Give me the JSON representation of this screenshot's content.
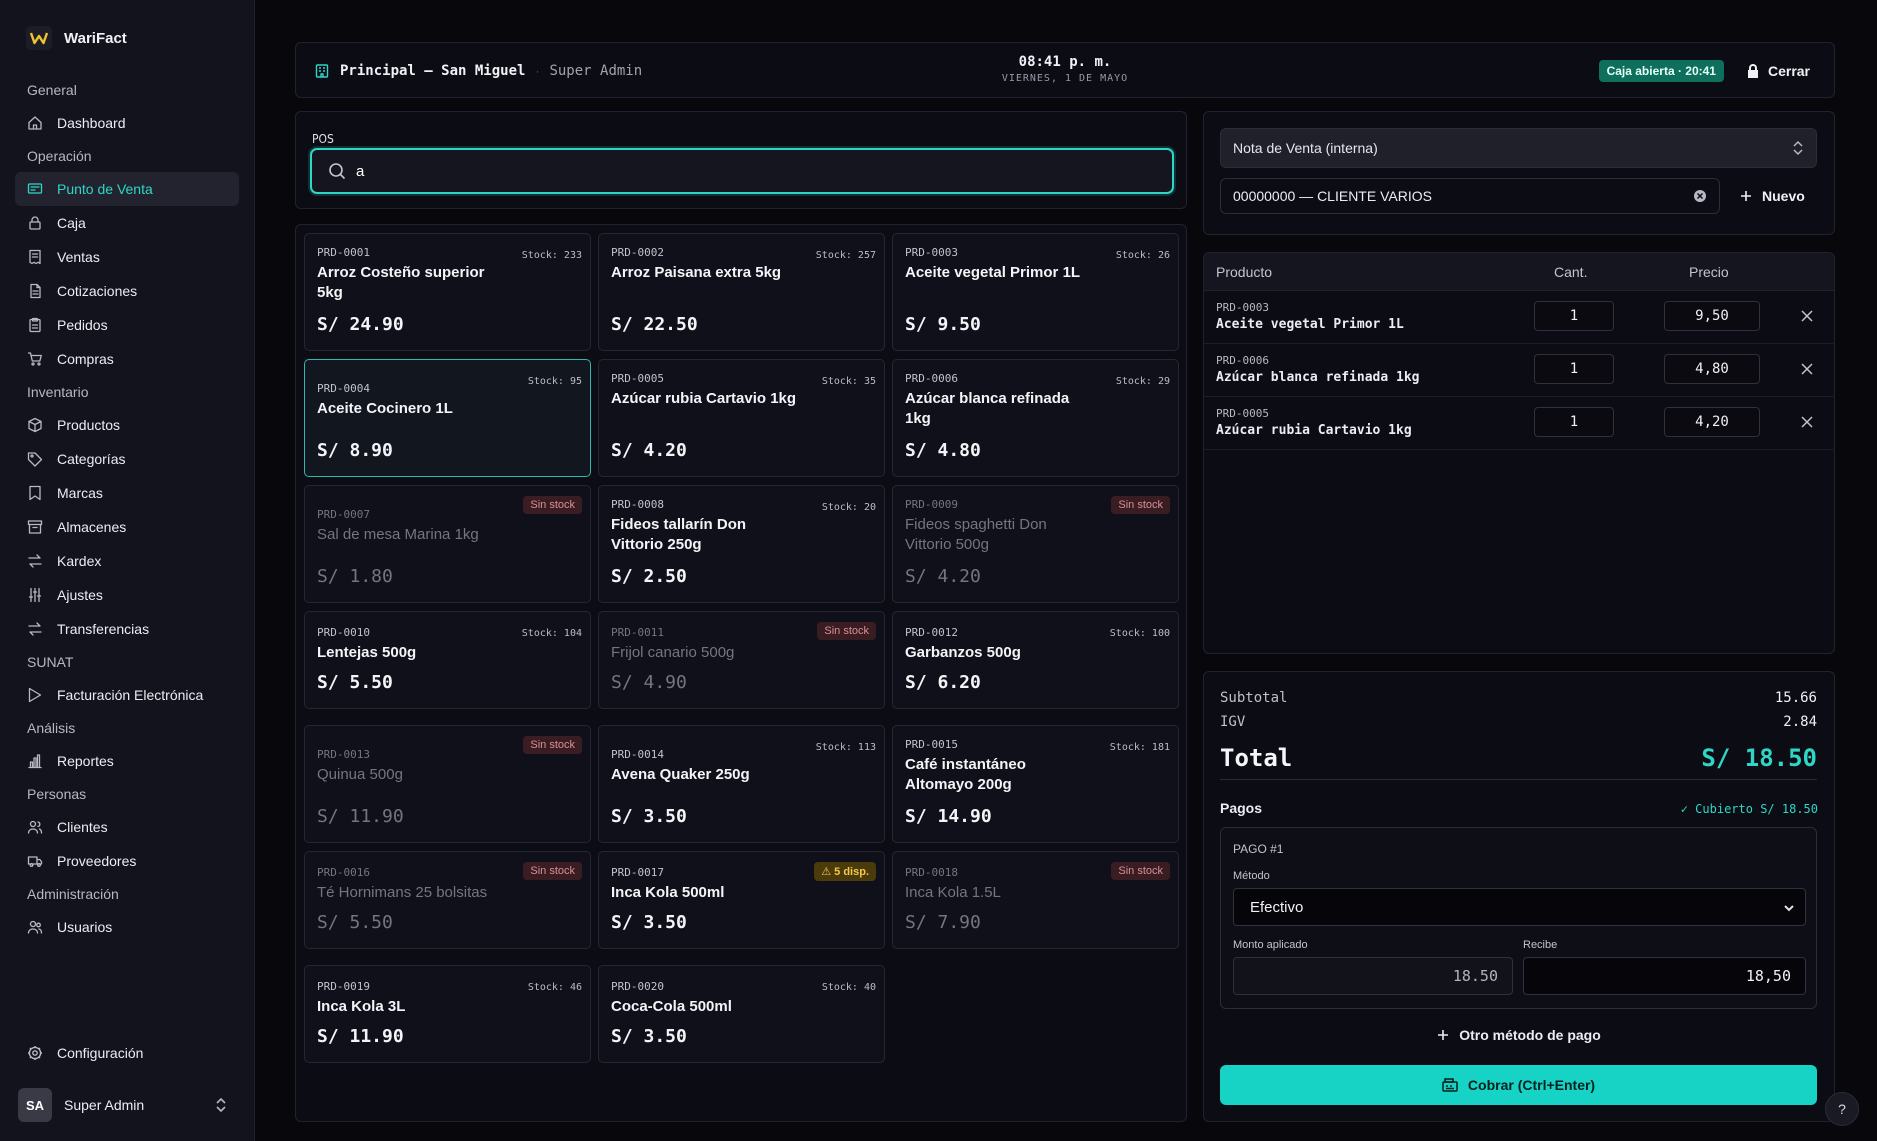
{
  "brand": {
    "name": "WariFact"
  },
  "sidebar": {
    "sections": [
      {
        "title": "General",
        "items": [
          {
            "label": "Dashboard",
            "icon": "home-icon"
          }
        ]
      },
      {
        "title": "Operación",
        "items": [
          {
            "label": "Punto de Venta",
            "icon": "pos-icon",
            "active": true
          },
          {
            "label": "Caja",
            "icon": "lock-icon"
          },
          {
            "label": "Ventas",
            "icon": "receipt-icon"
          },
          {
            "label": "Cotizaciones",
            "icon": "document-icon"
          },
          {
            "label": "Pedidos",
            "icon": "clipboard-icon"
          },
          {
            "label": "Compras",
            "icon": "cart-icon"
          }
        ]
      },
      {
        "title": "Inventario",
        "items": [
          {
            "label": "Productos",
            "icon": "box-icon"
          },
          {
            "label": "Categorías",
            "icon": "tag-icon"
          },
          {
            "label": "Marcas",
            "icon": "bookmark-icon"
          },
          {
            "label": "Almacenes",
            "icon": "archive-icon"
          },
          {
            "label": "Kardex",
            "icon": "swap-icon"
          },
          {
            "label": "Ajustes",
            "icon": "sliders-icon"
          },
          {
            "label": "Transferencias",
            "icon": "transfer-icon"
          }
        ]
      },
      {
        "title": "SUNAT",
        "items": [
          {
            "label": "Facturación Electrónica",
            "icon": "send-icon"
          }
        ]
      },
      {
        "title": "Análisis",
        "items": [
          {
            "label": "Reportes",
            "icon": "bar-chart-icon"
          }
        ]
      },
      {
        "title": "Personas",
        "items": [
          {
            "label": "Clientes",
            "icon": "users-icon"
          },
          {
            "label": "Proveedores",
            "icon": "truck-icon"
          }
        ]
      },
      {
        "title": "Administración",
        "items": [
          {
            "label": "Usuarios",
            "icon": "user-group-icon"
          }
        ]
      }
    ],
    "config_label": "Configuración",
    "user": {
      "initials": "SA",
      "name": "Super Admin"
    }
  },
  "header": {
    "store": "Principal — San Miguel",
    "role": "Super Admin",
    "time": "08:41 p. m.",
    "date": "VIERNES, 1 DE MAYO",
    "cash_status": "Caja abierta · 20:41",
    "close_label": "Cerrar"
  },
  "search": {
    "label": "POS",
    "value": "a"
  },
  "products": [
    {
      "code": "PRD-0001",
      "name": "Arroz Costeño superior 5kg",
      "price": "S/ 24.90",
      "stock": "Stock: 233",
      "status": "in"
    },
    {
      "code": "PRD-0002",
      "name": "Arroz Paisana extra 5kg",
      "price": "S/ 22.50",
      "stock": "Stock: 257",
      "status": "in"
    },
    {
      "code": "PRD-0003",
      "name": "Aceite vegetal Primor 1L",
      "price": "S/ 9.50",
      "stock": "Stock: 26",
      "status": "in"
    },
    {
      "code": "PRD-0004",
      "name": "Aceite Cocinero 1L",
      "price": "S/ 8.90",
      "stock": "Stock: 95",
      "status": "in",
      "selected": true
    },
    {
      "code": "PRD-0005",
      "name": "Azúcar rubia Cartavio 1kg",
      "price": "S/ 4.20",
      "stock": "Stock: 35",
      "status": "in"
    },
    {
      "code": "PRD-0006",
      "name": "Azúcar blanca refinada 1kg",
      "price": "S/ 4.80",
      "stock": "Stock: 29",
      "status": "in"
    },
    {
      "code": "PRD-0007",
      "name": "Sal de mesa Marina 1kg",
      "price": "S/ 1.80",
      "stock": "Sin stock",
      "status": "out"
    },
    {
      "code": "PRD-0008",
      "name": "Fideos tallarín Don Vittorio 250g",
      "price": "S/ 2.50",
      "stock": "Stock: 20",
      "status": "in"
    },
    {
      "code": "PRD-0009",
      "name": "Fideos spaghetti Don Vittorio 500g",
      "price": "S/ 4.20",
      "stock": "Sin stock",
      "status": "out"
    },
    {
      "code": "PRD-0010",
      "name": "Lentejas 500g",
      "price": "S/ 5.50",
      "stock": "Stock: 104",
      "status": "in"
    },
    {
      "code": "PRD-0011",
      "name": "Frijol canario 500g",
      "price": "S/ 4.90",
      "stock": "Sin stock",
      "status": "out"
    },
    {
      "code": "PRD-0012",
      "name": "Garbanzos 500g",
      "price": "S/ 6.20",
      "stock": "Stock: 100",
      "status": "in"
    },
    {
      "code": "PRD-0013",
      "name": "Quinua 500g",
      "price": "S/ 11.90",
      "stock": "Sin stock",
      "status": "out"
    },
    {
      "code": "PRD-0014",
      "name": "Avena Quaker 250g",
      "price": "S/ 3.50",
      "stock": "Stock: 113",
      "status": "in"
    },
    {
      "code": "PRD-0015",
      "name": "Café instantáneo Altomayo 200g",
      "price": "S/ 14.90",
      "stock": "Stock: 181",
      "status": "in"
    },
    {
      "code": "PRD-0016",
      "name": "Té Hornimans 25 bolsitas",
      "price": "S/ 5.50",
      "stock": "Sin stock",
      "status": "out"
    },
    {
      "code": "PRD-0017",
      "name": "Inca Kola 500ml",
      "price": "S/ 3.50",
      "stock": "⚠ 5 disp.",
      "status": "low"
    },
    {
      "code": "PRD-0018",
      "name": "Inca Kola 1.5L",
      "price": "S/ 7.90",
      "stock": "Sin stock",
      "status": "out"
    },
    {
      "code": "PRD-0019",
      "name": "Inca Kola 3L",
      "price": "S/ 11.90",
      "stock": "Stock: 46",
      "status": "in"
    },
    {
      "code": "PRD-0020",
      "name": "Coca-Cola 500ml",
      "price": "S/ 3.50",
      "stock": "Stock: 40",
      "status": "in"
    }
  ],
  "document": {
    "type": "Nota de Venta (interna)",
    "client": "00000000 — CLIENTE VARIOS",
    "new_label": "Nuevo"
  },
  "cart": {
    "headers": {
      "product": "Producto",
      "qty": "Cant.",
      "price": "Precio"
    },
    "items": [
      {
        "code": "PRD-0003",
        "name": "Aceite vegetal Primor 1L",
        "qty": "1",
        "price": "9,50"
      },
      {
        "code": "PRD-0006",
        "name": "Azúcar blanca refinada 1kg",
        "qty": "1",
        "price": "4,80"
      },
      {
        "code": "PRD-0005",
        "name": "Azúcar rubia Cartavio 1kg",
        "qty": "1",
        "price": "4,20"
      }
    ]
  },
  "totals": {
    "subtotal_label": "Subtotal",
    "subtotal": "15.66",
    "igv_label": "IGV",
    "igv": "2.84",
    "total_label": "Total",
    "total": "S/ 18.50"
  },
  "payments": {
    "label": "Pagos",
    "covered": "✓ Cubierto S/ 18.50",
    "title": "PAGO #1",
    "method_label": "Método",
    "method": "Efectivo",
    "applied_label": "Monto aplicado",
    "applied": "18.50",
    "receive_label": "Recibe",
    "receive": "18,50",
    "other_label": "Otro método de pago",
    "charge_label": "Cobrar (Ctrl+Enter)"
  },
  "help_label": "?",
  "colors": {
    "accent": "#2fd6c5",
    "out_of_stock": "#d98f97",
    "low_stock": "#f3c94a",
    "cash_open": "#0e6f5c"
  }
}
